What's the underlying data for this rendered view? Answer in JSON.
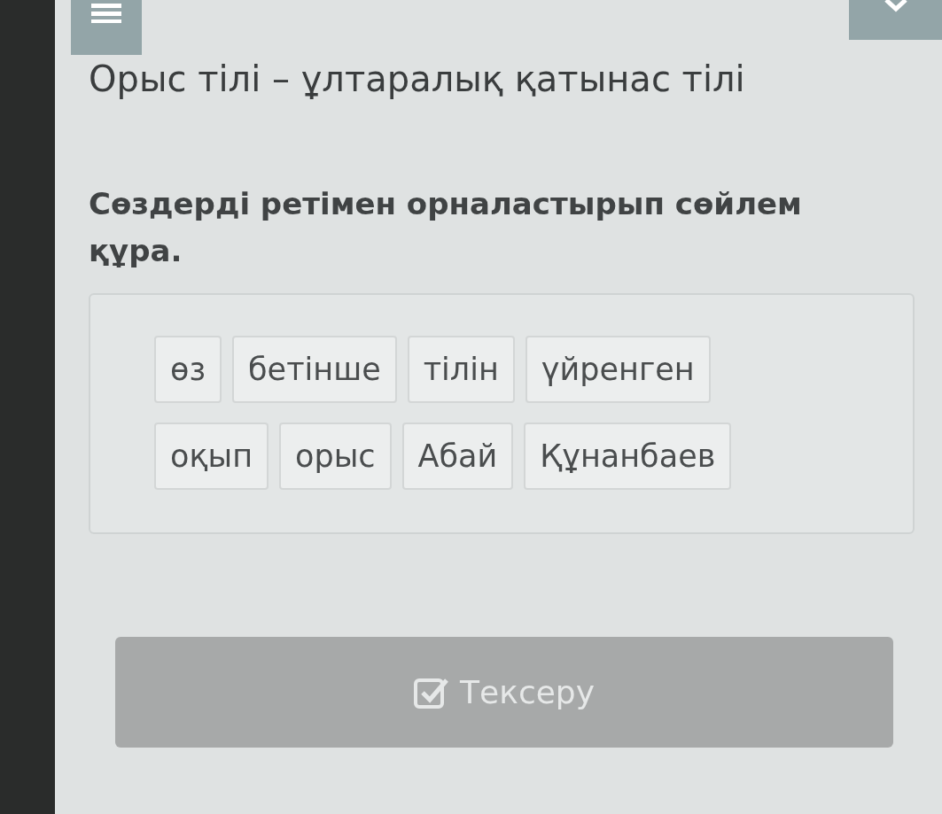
{
  "title": "Орыс тілі – ұлтаралық қатынас тілі",
  "question": "Сөздерді ретімен орналастырып сөйлем құра.",
  "word_rows": [
    [
      "өз",
      "бетінше",
      "тілін",
      "үйренген"
    ],
    [
      "оқып",
      "орыс",
      "Абай",
      "Құнанбаев"
    ]
  ],
  "check_button": {
    "label": "Тексеру",
    "disabled": true
  }
}
